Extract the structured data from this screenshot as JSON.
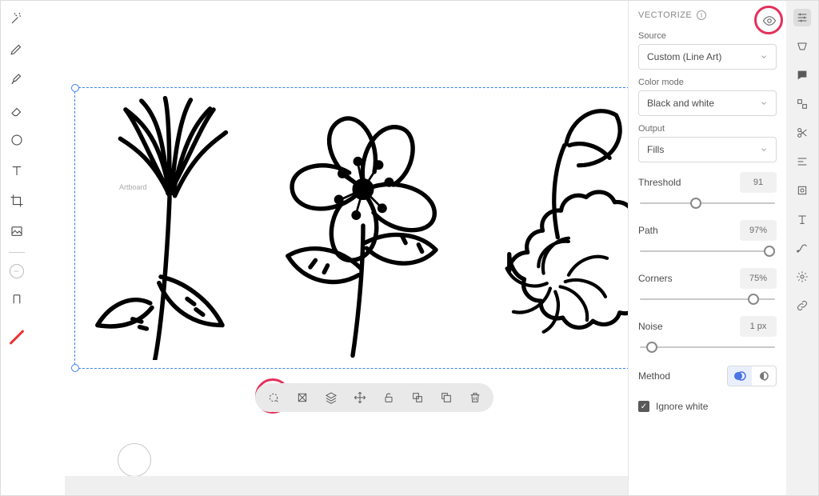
{
  "left_tools": [
    "magic-wand",
    "pen-tool",
    "brush",
    "eraser",
    "ellipse",
    "type",
    "crop",
    "image"
  ],
  "artboard_label": "Artboard",
  "float_tools": [
    "vectorize",
    "crop",
    "layers",
    "move",
    "unlock",
    "group",
    "duplicate",
    "trash"
  ],
  "panel": {
    "title": "VECTORIZE",
    "source_label": "Source",
    "source_value": "Custom (Line Art)",
    "colormode_label": "Color mode",
    "colormode_value": "Black and white",
    "output_label": "Output",
    "output_value": "Fills",
    "threshold_label": "Threshold",
    "threshold_value": "91",
    "path_label": "Path",
    "path_value": "97%",
    "corners_label": "Corners",
    "corners_value": "75%",
    "noise_label": "Noise",
    "noise_value": "1 px",
    "method_label": "Method",
    "ignore_label": "Ignore white"
  },
  "sliders": {
    "threshold_pct": 37,
    "path_pct": 92,
    "corners_pct": 80,
    "noise_pct": 5
  },
  "rail_icons": [
    "sliders",
    "swatches",
    "comments",
    "components",
    "scissors",
    "align",
    "focal",
    "text-styles",
    "curves",
    "gear",
    "link"
  ]
}
